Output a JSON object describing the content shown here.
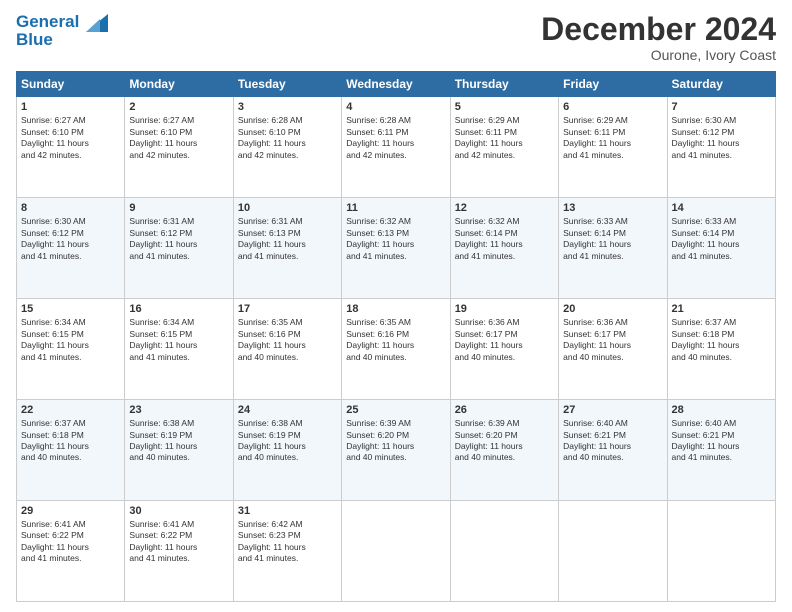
{
  "logo": {
    "line1": "General",
    "line2": "Blue"
  },
  "header": {
    "month_year": "December 2024",
    "location": "Ourone, Ivory Coast"
  },
  "days_of_week": [
    "Sunday",
    "Monday",
    "Tuesday",
    "Wednesday",
    "Thursday",
    "Friday",
    "Saturday"
  ],
  "weeks": [
    [
      {
        "day": "1",
        "text": "Sunrise: 6:27 AM\nSunset: 6:10 PM\nDaylight: 11 hours\nand 42 minutes."
      },
      {
        "day": "2",
        "text": "Sunrise: 6:27 AM\nSunset: 6:10 PM\nDaylight: 11 hours\nand 42 minutes."
      },
      {
        "day": "3",
        "text": "Sunrise: 6:28 AM\nSunset: 6:10 PM\nDaylight: 11 hours\nand 42 minutes."
      },
      {
        "day": "4",
        "text": "Sunrise: 6:28 AM\nSunset: 6:11 PM\nDaylight: 11 hours\nand 42 minutes."
      },
      {
        "day": "5",
        "text": "Sunrise: 6:29 AM\nSunset: 6:11 PM\nDaylight: 11 hours\nand 42 minutes."
      },
      {
        "day": "6",
        "text": "Sunrise: 6:29 AM\nSunset: 6:11 PM\nDaylight: 11 hours\nand 41 minutes."
      },
      {
        "day": "7",
        "text": "Sunrise: 6:30 AM\nSunset: 6:12 PM\nDaylight: 11 hours\nand 41 minutes."
      }
    ],
    [
      {
        "day": "8",
        "text": "Sunrise: 6:30 AM\nSunset: 6:12 PM\nDaylight: 11 hours\nand 41 minutes."
      },
      {
        "day": "9",
        "text": "Sunrise: 6:31 AM\nSunset: 6:12 PM\nDaylight: 11 hours\nand 41 minutes."
      },
      {
        "day": "10",
        "text": "Sunrise: 6:31 AM\nSunset: 6:13 PM\nDaylight: 11 hours\nand 41 minutes."
      },
      {
        "day": "11",
        "text": "Sunrise: 6:32 AM\nSunset: 6:13 PM\nDaylight: 11 hours\nand 41 minutes."
      },
      {
        "day": "12",
        "text": "Sunrise: 6:32 AM\nSunset: 6:14 PM\nDaylight: 11 hours\nand 41 minutes."
      },
      {
        "day": "13",
        "text": "Sunrise: 6:33 AM\nSunset: 6:14 PM\nDaylight: 11 hours\nand 41 minutes."
      },
      {
        "day": "14",
        "text": "Sunrise: 6:33 AM\nSunset: 6:14 PM\nDaylight: 11 hours\nand 41 minutes."
      }
    ],
    [
      {
        "day": "15",
        "text": "Sunrise: 6:34 AM\nSunset: 6:15 PM\nDaylight: 11 hours\nand 41 minutes."
      },
      {
        "day": "16",
        "text": "Sunrise: 6:34 AM\nSunset: 6:15 PM\nDaylight: 11 hours\nand 41 minutes."
      },
      {
        "day": "17",
        "text": "Sunrise: 6:35 AM\nSunset: 6:16 PM\nDaylight: 11 hours\nand 40 minutes."
      },
      {
        "day": "18",
        "text": "Sunrise: 6:35 AM\nSunset: 6:16 PM\nDaylight: 11 hours\nand 40 minutes."
      },
      {
        "day": "19",
        "text": "Sunrise: 6:36 AM\nSunset: 6:17 PM\nDaylight: 11 hours\nand 40 minutes."
      },
      {
        "day": "20",
        "text": "Sunrise: 6:36 AM\nSunset: 6:17 PM\nDaylight: 11 hours\nand 40 minutes."
      },
      {
        "day": "21",
        "text": "Sunrise: 6:37 AM\nSunset: 6:18 PM\nDaylight: 11 hours\nand 40 minutes."
      }
    ],
    [
      {
        "day": "22",
        "text": "Sunrise: 6:37 AM\nSunset: 6:18 PM\nDaylight: 11 hours\nand 40 minutes."
      },
      {
        "day": "23",
        "text": "Sunrise: 6:38 AM\nSunset: 6:19 PM\nDaylight: 11 hours\nand 40 minutes."
      },
      {
        "day": "24",
        "text": "Sunrise: 6:38 AM\nSunset: 6:19 PM\nDaylight: 11 hours\nand 40 minutes."
      },
      {
        "day": "25",
        "text": "Sunrise: 6:39 AM\nSunset: 6:20 PM\nDaylight: 11 hours\nand 40 minutes."
      },
      {
        "day": "26",
        "text": "Sunrise: 6:39 AM\nSunset: 6:20 PM\nDaylight: 11 hours\nand 40 minutes."
      },
      {
        "day": "27",
        "text": "Sunrise: 6:40 AM\nSunset: 6:21 PM\nDaylight: 11 hours\nand 40 minutes."
      },
      {
        "day": "28",
        "text": "Sunrise: 6:40 AM\nSunset: 6:21 PM\nDaylight: 11 hours\nand 41 minutes."
      }
    ],
    [
      {
        "day": "29",
        "text": "Sunrise: 6:41 AM\nSunset: 6:22 PM\nDaylight: 11 hours\nand 41 minutes."
      },
      {
        "day": "30",
        "text": "Sunrise: 6:41 AM\nSunset: 6:22 PM\nDaylight: 11 hours\nand 41 minutes."
      },
      {
        "day": "31",
        "text": "Sunrise: 6:42 AM\nSunset: 6:23 PM\nDaylight: 11 hours\nand 41 minutes."
      },
      {
        "day": "",
        "text": ""
      },
      {
        "day": "",
        "text": ""
      },
      {
        "day": "",
        "text": ""
      },
      {
        "day": "",
        "text": ""
      }
    ]
  ]
}
